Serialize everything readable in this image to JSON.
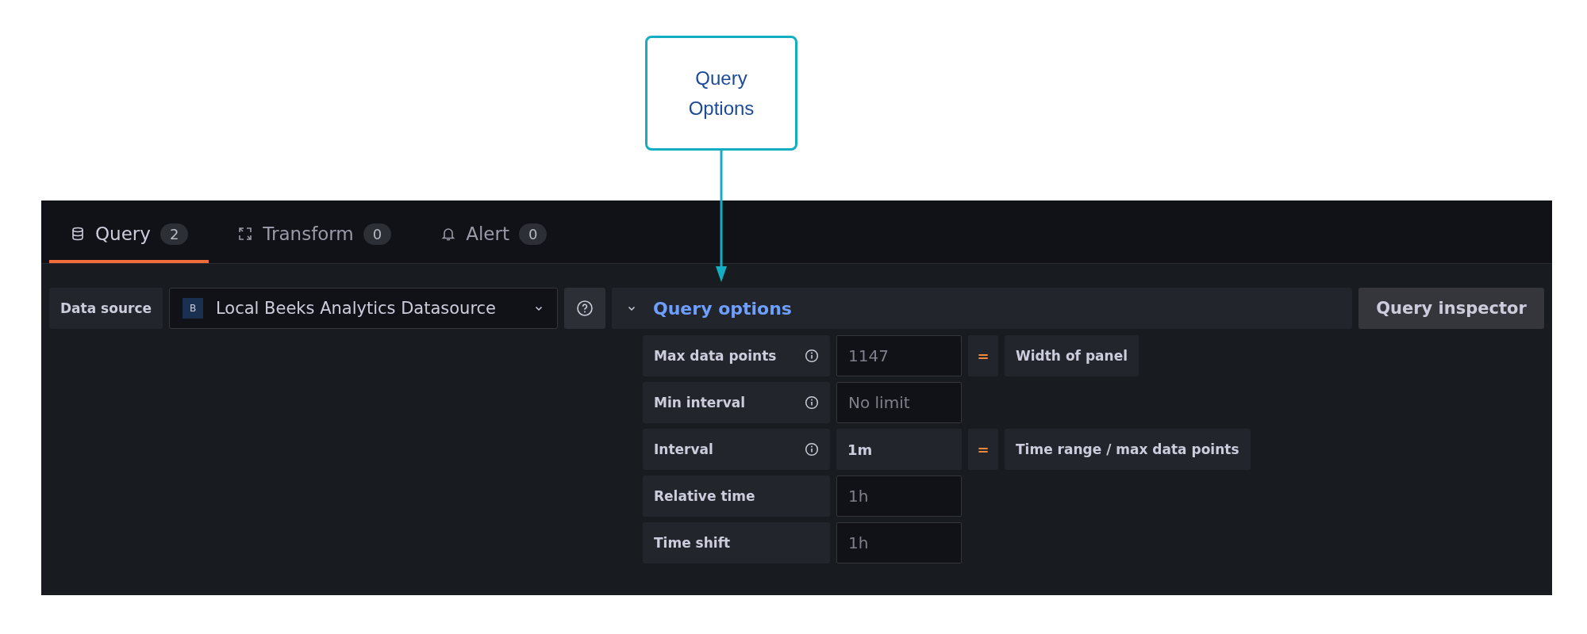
{
  "annotation": {
    "text": "Query Options"
  },
  "tabs": [
    {
      "label": "Query",
      "count": "2",
      "selected": true
    },
    {
      "label": "Transform",
      "count": "0",
      "selected": false
    },
    {
      "label": "Alert",
      "count": "0",
      "selected": false
    }
  ],
  "data_source": {
    "label": "Data source",
    "value": "Local Beeks Analytics Datasource",
    "logo": "B"
  },
  "query_options": {
    "title": "Query options",
    "expanded": true,
    "rows": [
      {
        "label": "Max data points",
        "info": true,
        "kind": "input",
        "placeholder": "1147",
        "operator": "=",
        "note": "Width of panel"
      },
      {
        "label": "Min interval",
        "info": true,
        "kind": "input",
        "placeholder": "No limit"
      },
      {
        "label": "Interval",
        "info": true,
        "kind": "value",
        "value": "1m",
        "operator": "=",
        "note": "Time range / max data points"
      },
      {
        "label": "Relative time",
        "info": false,
        "kind": "input",
        "placeholder": "1h"
      },
      {
        "label": "Time shift",
        "info": false,
        "kind": "input",
        "placeholder": "1h"
      }
    ]
  },
  "query_inspector": {
    "label": "Query inspector"
  }
}
